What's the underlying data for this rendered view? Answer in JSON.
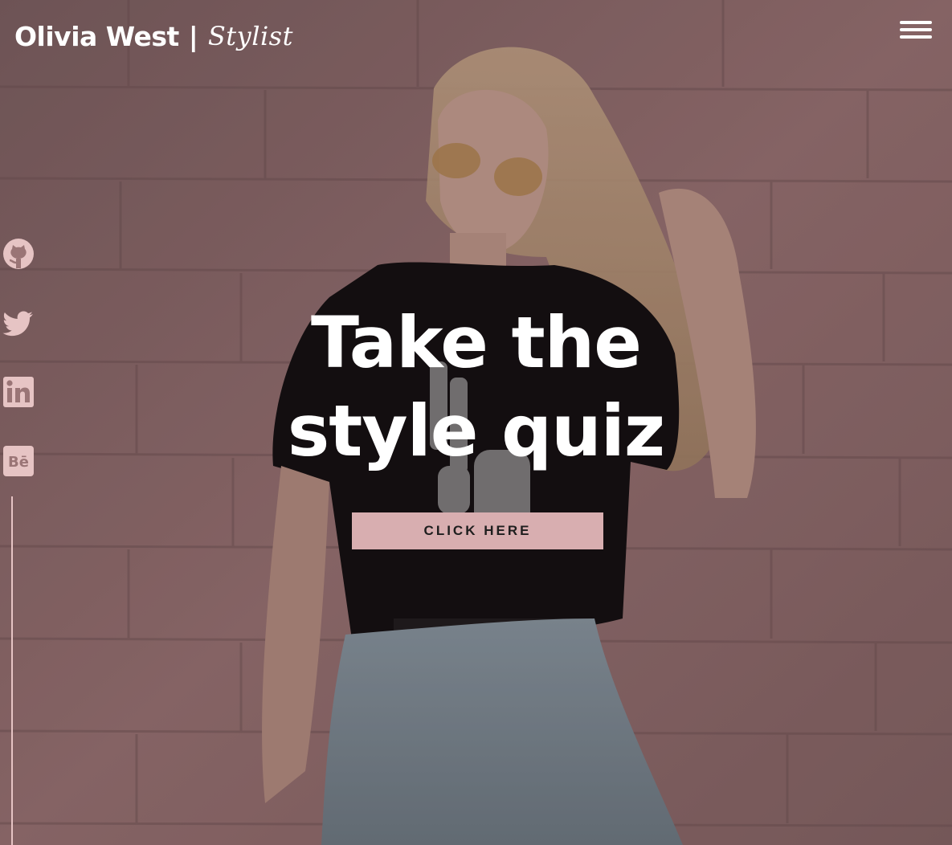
{
  "header": {
    "brand_name": "Olivia West",
    "separator": "|",
    "brand_tagline": "Stylist",
    "menu_icon": "hamburger-menu-icon"
  },
  "social": {
    "items": [
      {
        "name": "github",
        "icon": "github-icon"
      },
      {
        "name": "twitter",
        "icon": "twitter-icon"
      },
      {
        "name": "linkedin",
        "icon": "linkedin-icon"
      },
      {
        "name": "behance",
        "icon": "behance-icon"
      }
    ],
    "icon_color": "#e6c4c4"
  },
  "hero": {
    "title_line1": "Take the",
    "title_line2": "style quiz",
    "cta_label": "CLICK HERE",
    "cta_color": "#d8aeb0",
    "background_color": "#8b6a6a"
  }
}
